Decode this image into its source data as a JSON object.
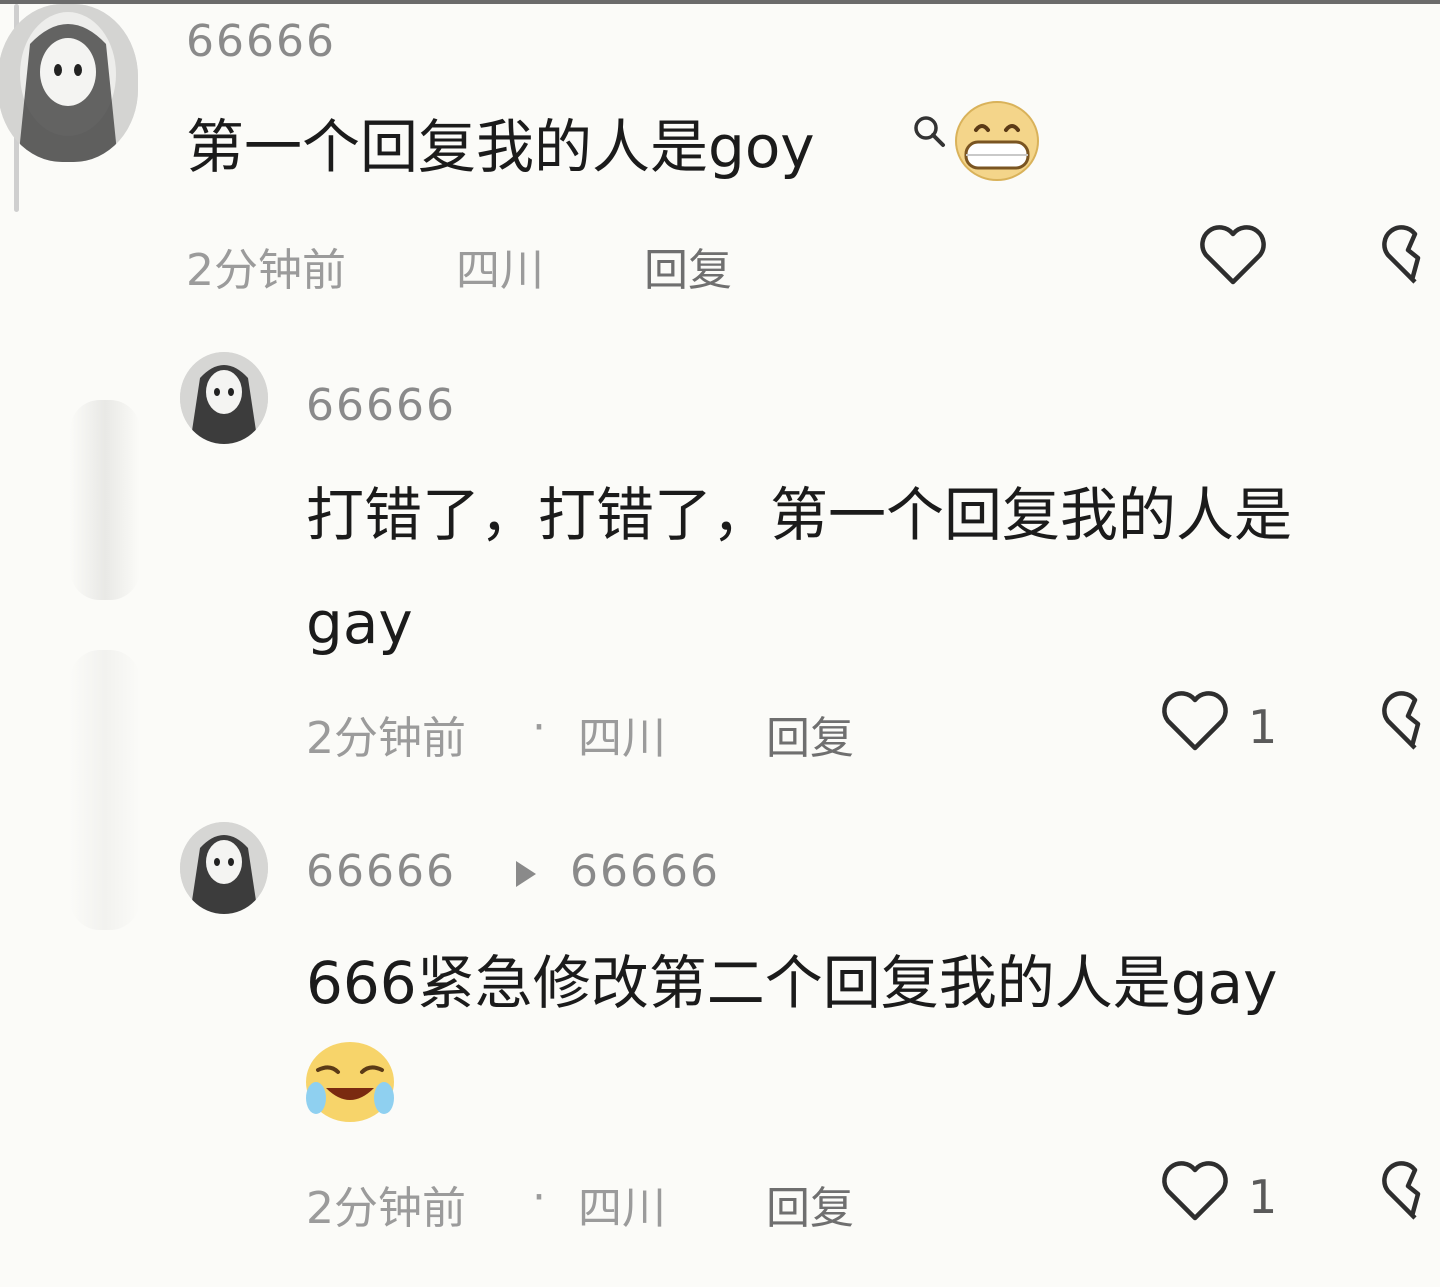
{
  "comments": [
    {
      "username": "66666",
      "text": "第一个回复我的人是goy",
      "time": "2分钟前",
      "location": "四川",
      "reply_label": "回复",
      "emoji": "grin-emoji"
    },
    {
      "username": "66666",
      "text_line1": "打错了，打错了，第一个回复我的人是",
      "text_line2": "gay",
      "time": "2分钟前",
      "separator": "·",
      "location": "四川",
      "reply_label": "回复",
      "likes": "1"
    },
    {
      "username": "66666",
      "reply_to": "66666",
      "text": "666紧急修改第二个回复我的人是gay",
      "emoji": "laugh-cry-emoji",
      "time": "2分钟前",
      "separator": "·",
      "location": "四川",
      "reply_label": "回复",
      "likes": "1"
    }
  ],
  "icons": {
    "like": "heart-outline-icon",
    "dislike": "broken-heart-icon",
    "reply_arrow": "play-arrow-icon",
    "search_hint": "search-icon"
  },
  "colors": {
    "background": "#fbfbf8",
    "text": "#1b1b1b",
    "muted": "#9b9b9b",
    "username": "#8a8a8a"
  }
}
